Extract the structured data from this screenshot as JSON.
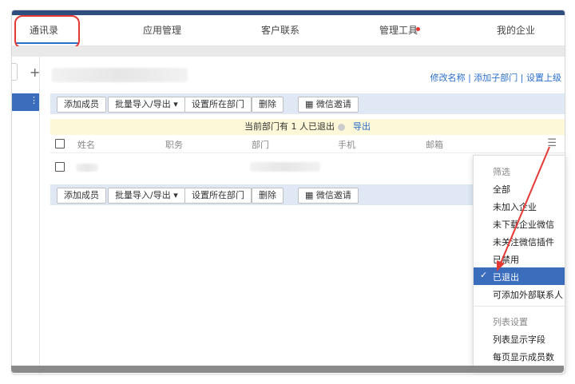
{
  "nav": {
    "tabs": [
      "通讯录",
      "应用管理",
      "客户联系",
      "管理工具",
      "我的企业"
    ]
  },
  "sidebar": {
    "add_label": "+",
    "selected_label": "⋮"
  },
  "dept": {
    "links": "修改名称 | 添加子部门 | 设置上级"
  },
  "toolbar": {
    "add_member": "添加成员",
    "batch": "批量导入/导出 ▾",
    "set_dept": "设置所在部门",
    "delete": "删除",
    "wechat_invite": "微信邀请"
  },
  "notice": {
    "text": "当前部门有 1 人已退出",
    "export": "导出"
  },
  "table": {
    "headers": [
      "姓名",
      "职务",
      "部门",
      "手机",
      "邮箱"
    ]
  },
  "dropdown": {
    "filter_title": "筛选",
    "filter_items": [
      "全部",
      "未加入企业",
      "未下载企业微信",
      "未关注微信插件",
      "已禁用"
    ],
    "selected": "已退出",
    "after_selected": "可添加外部联系人",
    "list_title": "列表设置",
    "list_items": [
      "列表显示字段",
      "每页显示成员数"
    ]
  },
  "colors": {
    "accent": "#2a6ecb",
    "top_bar": "#2f4e7f",
    "highlight": "#3b6dbd",
    "annotation": "#e53935"
  }
}
